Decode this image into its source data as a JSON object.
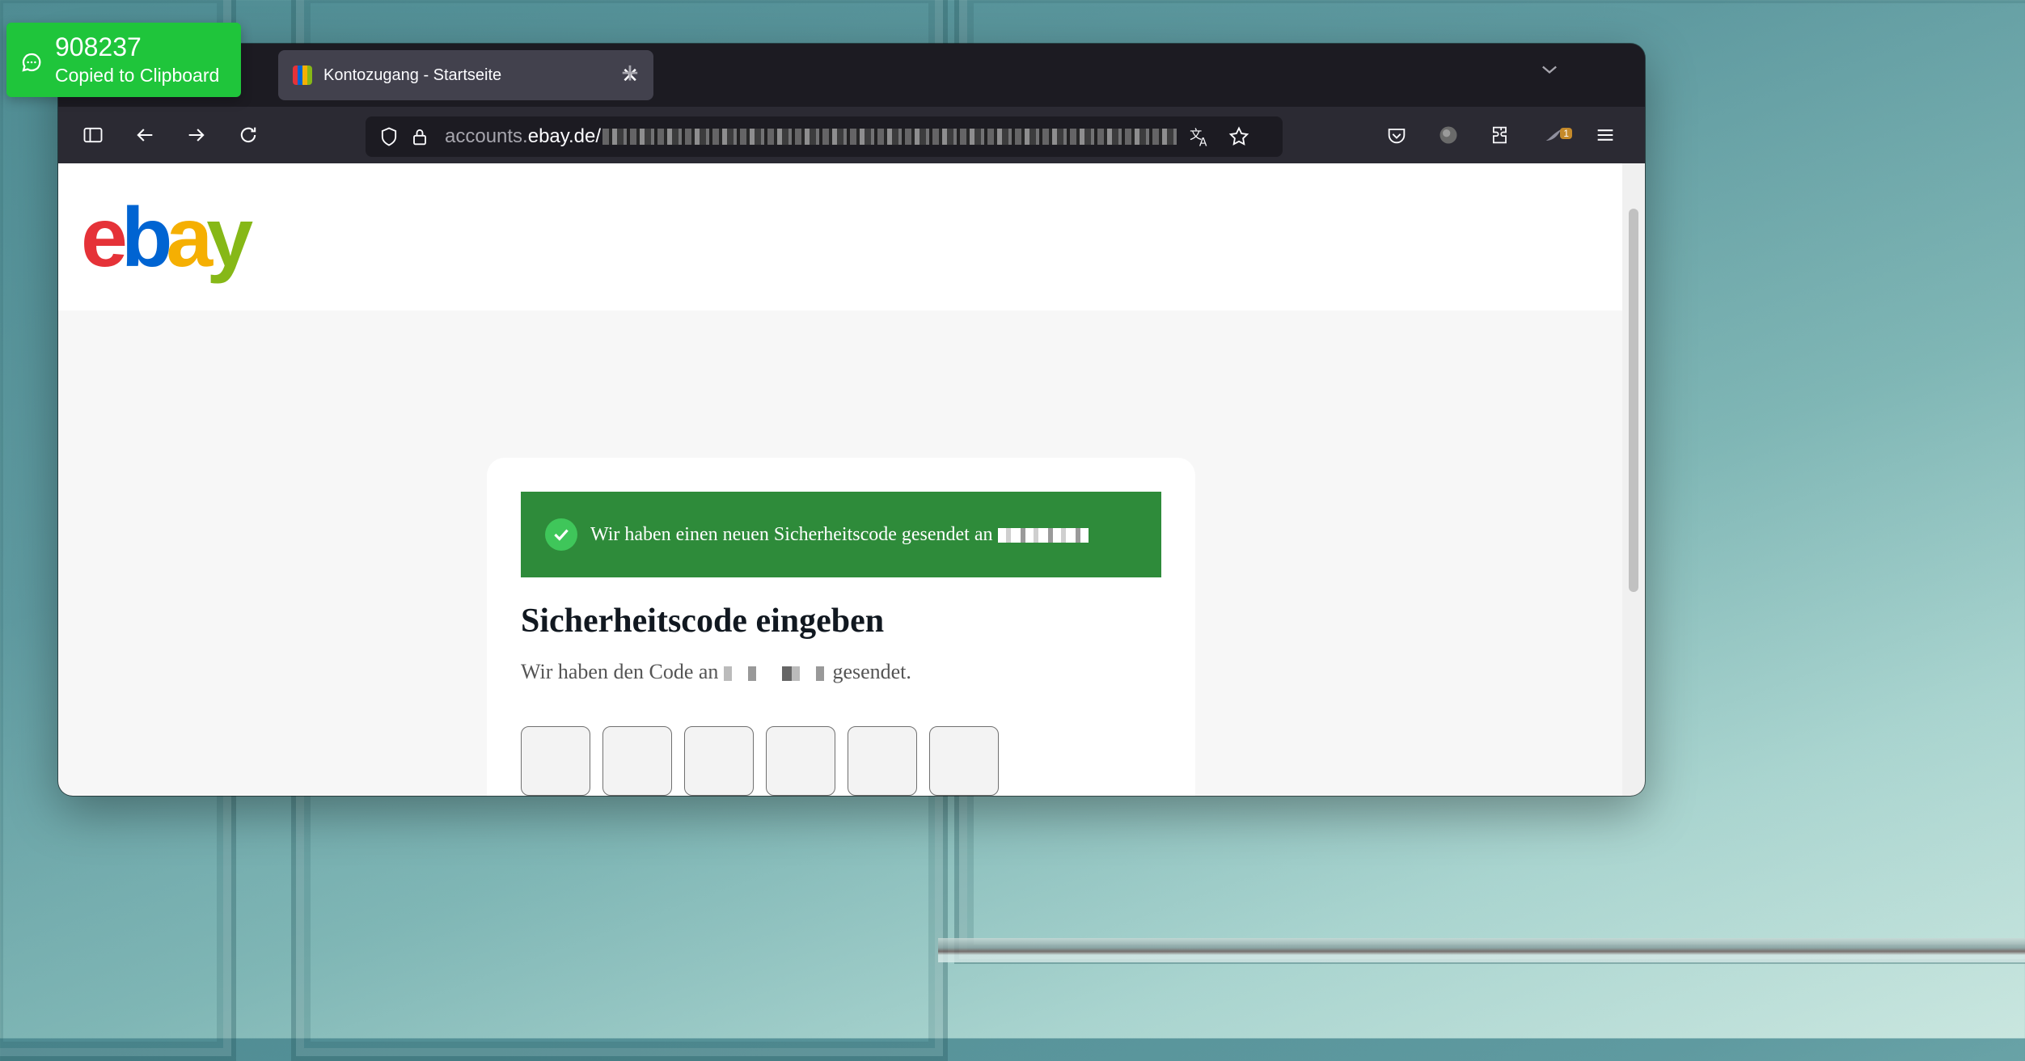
{
  "toast": {
    "code": "908237",
    "message": "Copied to Clipboard"
  },
  "browser": {
    "tab_title": "Kontozugang - Startseite",
    "url_prefix": "accounts.",
    "url_domain": "ebay.de/",
    "extension_badge": "1"
  },
  "page": {
    "logo": {
      "e": "e",
      "b": "b",
      "a": "a",
      "y": "y"
    },
    "alert_text": "Wir haben einen neuen Sicherheitscode gesendet an",
    "heading": "Sicherheitscode eingeben",
    "subtext_before": "Wir haben den Code an",
    "subtext_after": "gesendet.",
    "otp_values": [
      "",
      "",
      "",
      "",
      "",
      ""
    ]
  },
  "colors": {
    "alert_bg": "#2e8b3a",
    "toast_bg": "#1fc53b",
    "ebay_red": "#e53238",
    "ebay_blue": "#0064d2",
    "ebay_yellow": "#f5af02",
    "ebay_green": "#86b817"
  }
}
